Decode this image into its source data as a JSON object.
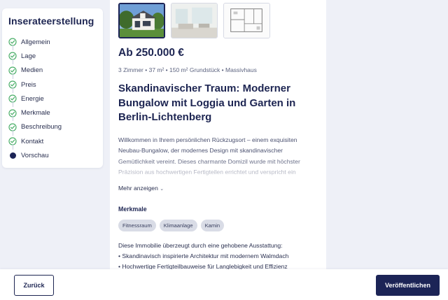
{
  "sidebar": {
    "title": "Inserateerstellung",
    "steps": [
      {
        "label": "Allgemein",
        "state": "done"
      },
      {
        "label": "Lage",
        "state": "done"
      },
      {
        "label": "Medien",
        "state": "done"
      },
      {
        "label": "Preis",
        "state": "done"
      },
      {
        "label": "Energie",
        "state": "done"
      },
      {
        "label": "Merkmale",
        "state": "done"
      },
      {
        "label": "Beschreibung",
        "state": "done"
      },
      {
        "label": "Kontakt",
        "state": "done"
      },
      {
        "label": "Vorschau",
        "state": "current"
      }
    ]
  },
  "listing": {
    "thumbnails": [
      "house-exterior-photo",
      "interior-photo",
      "floor-plan"
    ],
    "price": "Ab 250.000 €",
    "facts": "3 Zimmer • 37 m² • 150 m² Grundstück • Massivhaus",
    "title": "Skandinavischer Traum: Moderner Bungalow mit Loggia und Garten in Berlin-Lichtenberg",
    "description": "Willkommen in Ihrem persönlichen Rückzugsort – einem exquisiten Neubau-Bungalow, der modernes Design mit skandinavischer Gemütlichkeit vereint. Dieses charmante Domizil wurde mit höchster Präzision aus hochwertigen Fertigteilen errichtet und verspricht ein Wohngefühl der Extraklasse. Die durchdachte Raumaufteilung auf einer",
    "more_label": "Mehr anzeigen",
    "features_title": "Merkmale",
    "features_chips": [
      "Fitnessraum",
      "Klimaanlage",
      "Kamin"
    ],
    "features_intro": "Diese Immobilie überzeugt durch eine gehobene Ausstattung:",
    "features_list": [
      "• Skandinavisch inspirierte Architektur mit modernem Walmdach",
      "• Hochwertige Fertigteilbauweise für Langlebigkeit und Effizienz"
    ]
  },
  "footer": {
    "back_label": "Zurück",
    "publish_label": "Veröffentlichen"
  },
  "colors": {
    "primary": "#1c2456",
    "check": "#4caf6a",
    "background": "#eef0f7"
  }
}
